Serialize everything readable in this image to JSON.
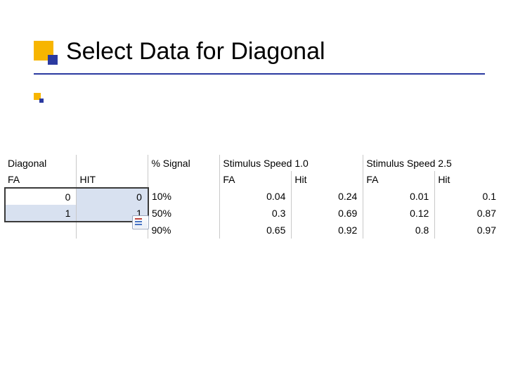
{
  "title": "Select Data for Diagonal",
  "headers_row1": {
    "c0": "Diagonal",
    "c1": "",
    "c2": "% Signal",
    "c3": "Stimulus Speed 1.0",
    "c4": "",
    "c5": "Stimulus Speed 2.5",
    "c6": ""
  },
  "headers_row2": {
    "c0": "FA",
    "c1": "HIT",
    "c2": "",
    "c3": "FA",
    "c4": "Hit",
    "c5": "FA",
    "c6": "Hit"
  },
  "rows": [
    {
      "fa_diag": "0",
      "hit_diag": "0",
      "pct": "10%",
      "fa10": "0.04",
      "hit10": "0.24",
      "fa25": "0.01",
      "hit25": "0.1"
    },
    {
      "fa_diag": "1",
      "hit_diag": "1",
      "pct": "50%",
      "fa10": "0.3",
      "hit10": "0.69",
      "fa25": "0.12",
      "hit25": "0.87"
    },
    {
      "fa_diag": "",
      "hit_diag": "",
      "pct": "90%",
      "fa10": "0.65",
      "hit10": "0.92",
      "fa25": "0.8",
      "hit25": "0.97"
    }
  ]
}
